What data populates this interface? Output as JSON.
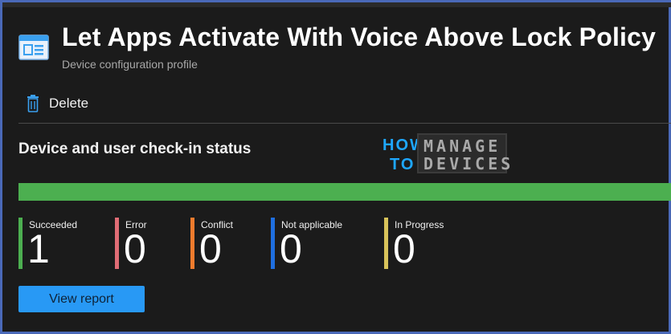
{
  "header": {
    "title": "Let Apps Activate With Voice Above Lock Policy",
    "subtitle": "Device configuration profile",
    "icon": "profile-blade-icon"
  },
  "toolbar": {
    "delete_label": "Delete",
    "delete_icon": "trash-icon"
  },
  "checkin": {
    "section_title": "Device and user check-in status",
    "success_fraction": 1.0,
    "bar_color": "#4caf50",
    "stats": [
      {
        "label": "Succeeded",
        "value": "1",
        "color": "#4caf50"
      },
      {
        "label": "Error",
        "value": "0",
        "color": "#e06c75"
      },
      {
        "label": "Conflict",
        "value": "0",
        "color": "#f07b2d"
      },
      {
        "label": "Not applicable",
        "value": "0",
        "color": "#1f6fe0"
      },
      {
        "label": "In Progress",
        "value": "0",
        "color": "#d8c35a"
      }
    ],
    "view_report_label": "View report"
  },
  "watermark": {
    "how": "HOW",
    "to": "TO",
    "manage": "MANAGE",
    "devices": "DEVICES"
  },
  "colors": {
    "accent": "#2899f5",
    "background": "#1b1b1b",
    "frame": "#4a69b8"
  }
}
